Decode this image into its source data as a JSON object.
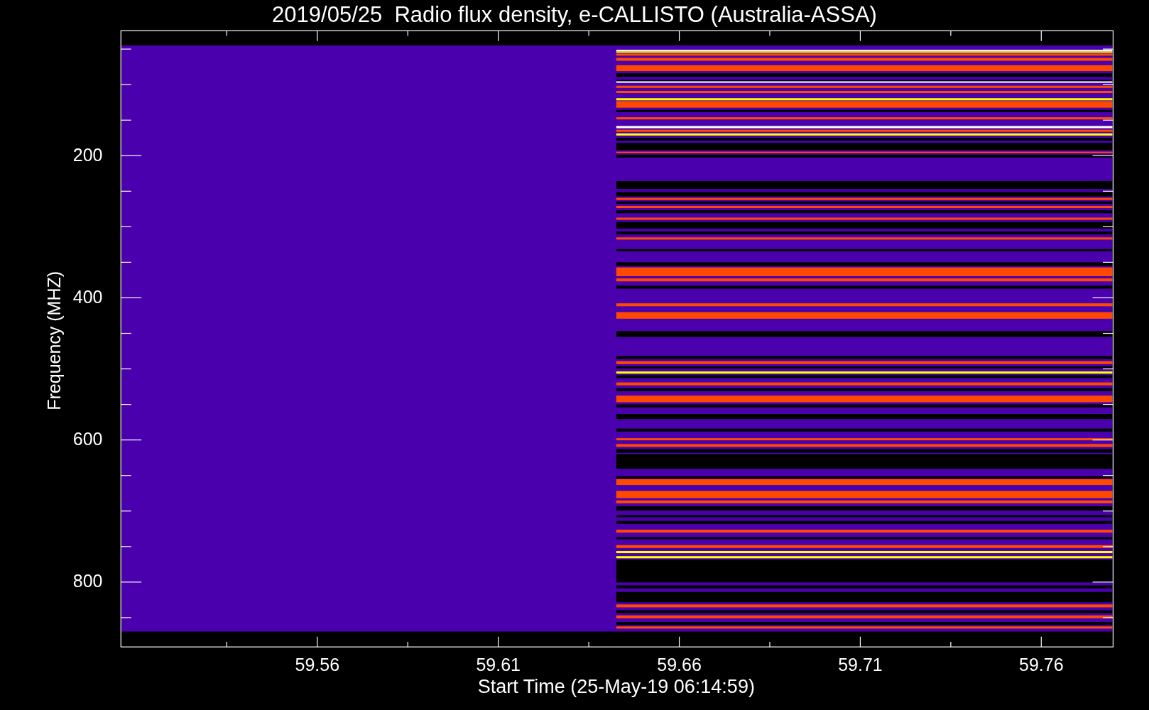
{
  "title": "2019/05/25  Radio flux density, e-CALLISTO (Australia-ASSA)",
  "plot": {
    "ylabel": "Frequency (MHZ)",
    "xlabel": "Start Time (25-May-19 06:14:59)",
    "yticks": [
      "200",
      "400",
      "600",
      "800"
    ],
    "xticks": [
      "59.56",
      "59.61",
      "59.66",
      "59.71",
      "59.76"
    ]
  }
}
